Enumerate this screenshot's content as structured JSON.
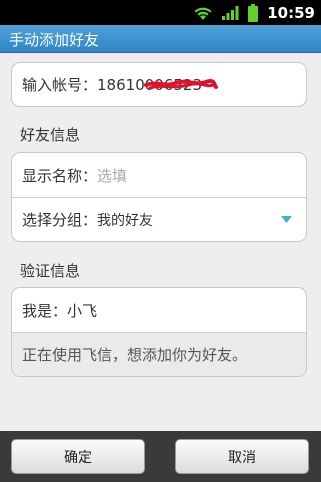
{
  "status_bar": {
    "time": "10:59",
    "icons": [
      "wifi-icon",
      "signal-icon",
      "battery-icon"
    ]
  },
  "title_bar": {
    "title": "手动添加好友"
  },
  "account": {
    "label": "输入帐号：",
    "value": "18610006523"
  },
  "friend_info": {
    "heading": "好友信息",
    "display_name_label": "显示名称：",
    "display_name_placeholder": "选填",
    "group_label": "选择分组：",
    "group_value": "我的好友"
  },
  "verify_info": {
    "heading": "验证信息",
    "iam_label": "我是：",
    "iam_value": "小飞",
    "message": "正在使用飞信，想添加你为好友。"
  },
  "buttons": {
    "confirm": "确定",
    "cancel": "取消"
  },
  "colors": {
    "title_bar": "#3a93d0",
    "accent_arrow": "#3bb0d9",
    "redaction": "#e0122a"
  }
}
